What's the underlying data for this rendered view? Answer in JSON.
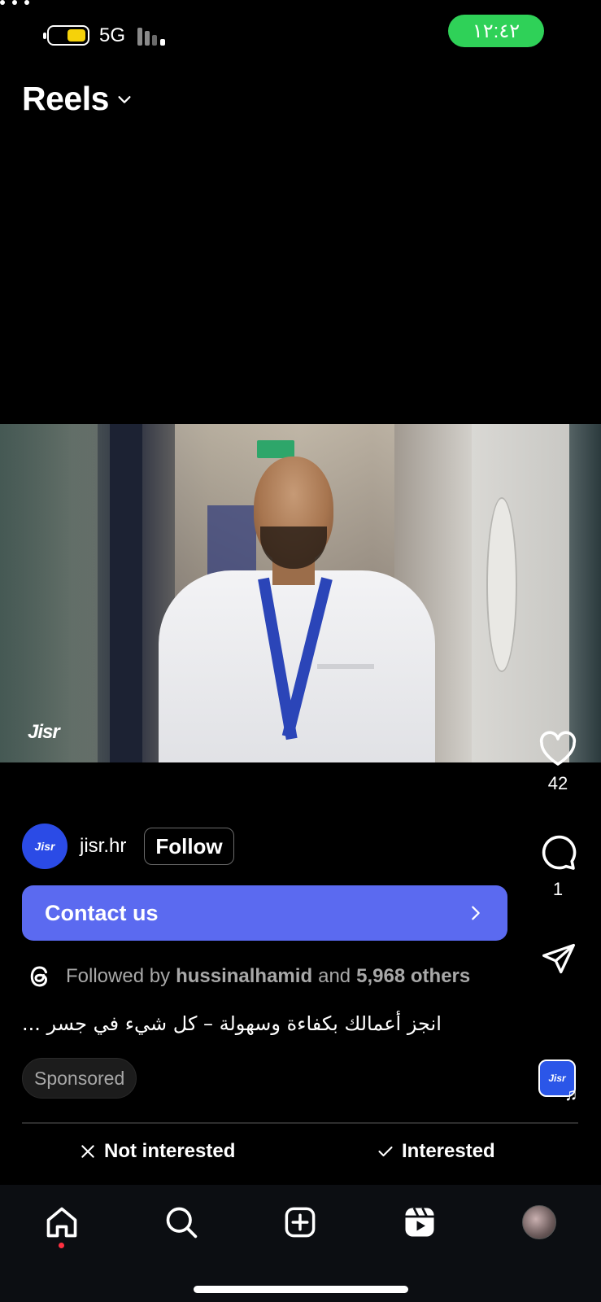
{
  "status_bar": {
    "time": "١٢:٤٢",
    "network": "5G",
    "battery_level": "low",
    "time_pill_color": "#2fd158"
  },
  "header": {
    "title": "Reels",
    "dropdown_icon": "chevron-down-icon"
  },
  "video": {
    "watermark": "Jisr"
  },
  "actions": {
    "like_count": "42",
    "comment_count": "1",
    "like_icon": "heart-icon",
    "comment_icon": "comment-icon",
    "share_icon": "send-icon",
    "more_icon": "more-icon",
    "audio_label": "Jisr"
  },
  "author": {
    "avatar_text": "Jisr",
    "username": "jisr.hr",
    "follow_label": "Follow"
  },
  "cta": {
    "label": "Contact us",
    "color": "#5b6af0"
  },
  "followed_by": {
    "prefix": "Followed by",
    "user": "hussinalhamid",
    "conjunction": "and",
    "others": "5,968 others"
  },
  "caption": {
    "text": "انجز أعمالك بكفاءة وسهولة – كل شيء في جسر ..."
  },
  "sponsored_label": "Sponsored",
  "interest": {
    "not_interested": "Not interested",
    "interested": "Interested"
  },
  "tabbar": {
    "items": [
      "home-icon",
      "search-icon",
      "create-icon",
      "reels-icon",
      "profile-avatar"
    ],
    "active": "reels-icon"
  }
}
